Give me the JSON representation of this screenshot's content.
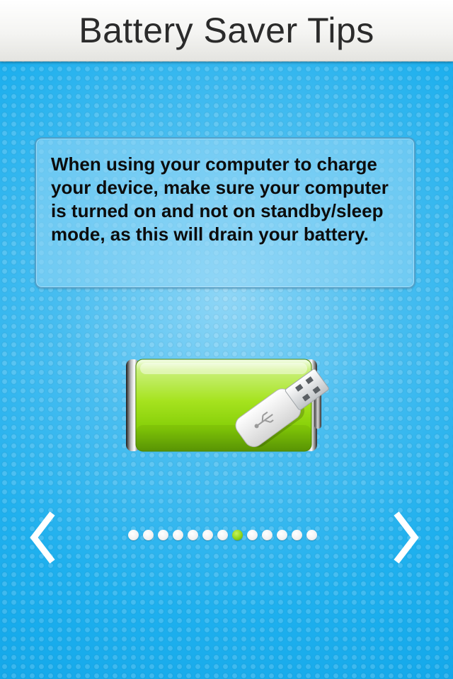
{
  "header": {
    "title": "Battery Saver Tips"
  },
  "tip": {
    "text": "When using your computer to charge your device, make sure your computer is turned on and not on standby/sleep mode, as this will drain your battery."
  },
  "illustration": {
    "icon": "battery-usb-icon",
    "battery_level": 1.0,
    "battery_color": "#9fe01e"
  },
  "pagination": {
    "total": 13,
    "current": 8
  },
  "nav": {
    "prev_icon": "chevron-left-icon",
    "next_icon": "chevron-right-icon"
  },
  "colors": {
    "background": "#1fb0ee",
    "active_dot": "#8fd51a"
  }
}
